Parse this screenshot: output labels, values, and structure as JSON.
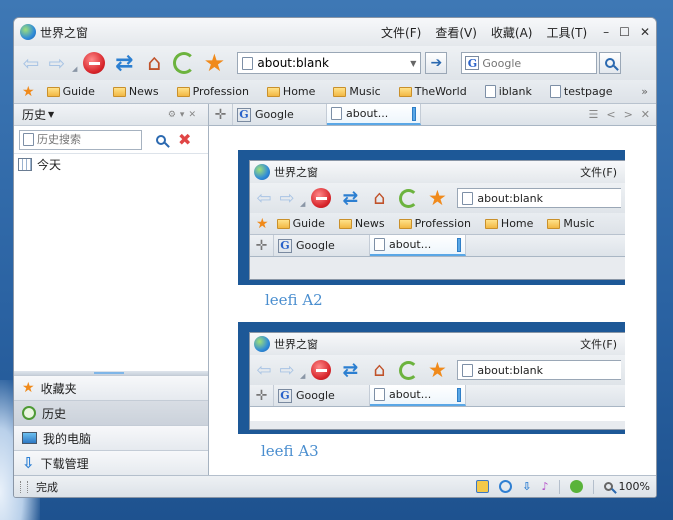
{
  "window": {
    "title": "世界之窗",
    "controls": [
      "–",
      "☐",
      "✕"
    ]
  },
  "menu": [
    "文件(F)",
    "查看(V)",
    "收藏(A)",
    "工具(T)"
  ],
  "address": {
    "value": "about:blank"
  },
  "search": {
    "placeholder": "Google"
  },
  "favorites": [
    "Guide",
    "News",
    "Profession",
    "Home",
    "Music",
    "TheWorld",
    "iblank",
    "testpage"
  ],
  "more": "»",
  "sidebar": {
    "header": "历史",
    "search_placeholder": "历史搜索",
    "tree": [
      {
        "label": "今天"
      }
    ],
    "panels": [
      {
        "label": "收藏夹",
        "icon": "star-icon"
      },
      {
        "label": "历史",
        "icon": "clock-icon",
        "selected": true
      },
      {
        "label": "我的电脑",
        "icon": "computer-icon"
      },
      {
        "label": "下载管理",
        "icon": "download-icon"
      }
    ]
  },
  "tabs": [
    {
      "label": "Google",
      "icon": "google-icon"
    },
    {
      "label": "about...",
      "icon": "page-icon",
      "active": true
    }
  ],
  "previews": [
    {
      "caption": "leefi A2",
      "title": "世界之窗",
      "menu": "文件(F)",
      "address": "about:blank",
      "favorites": [
        "Guide",
        "News",
        "Profession",
        "Home",
        "Music"
      ],
      "tabs": [
        "Google",
        "about..."
      ]
    },
    {
      "caption": "leefi A3",
      "title": "世界之窗",
      "menu": "文件(F)",
      "address": "about:blank",
      "tabs": [
        "Google",
        "about..."
      ]
    }
  ],
  "status": {
    "text": "完成",
    "zoom": "100%"
  },
  "colors": {
    "accent": "#5aa7e6",
    "frame": "#1d5897",
    "caption": "#4a8ecf"
  }
}
